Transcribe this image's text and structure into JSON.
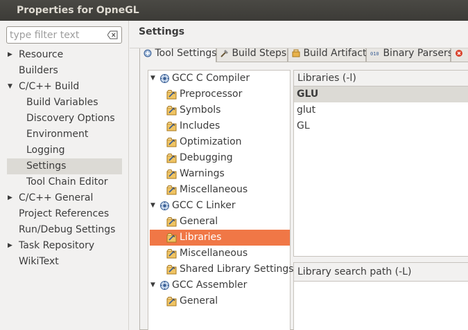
{
  "window": {
    "title": "Properties for OpneGL"
  },
  "filter": {
    "placeholder": "type filter text",
    "value": ""
  },
  "nav": [
    {
      "label": "Resource",
      "expandable": true,
      "expanded": false,
      "level": 0
    },
    {
      "label": "Builders",
      "expandable": false,
      "level": 0
    },
    {
      "label": "C/C++ Build",
      "expandable": true,
      "expanded": true,
      "level": 0
    },
    {
      "label": "Build Variables",
      "level": 1
    },
    {
      "label": "Discovery Options",
      "level": 1
    },
    {
      "label": "Environment",
      "level": 1
    },
    {
      "label": "Logging",
      "level": 1
    },
    {
      "label": "Settings",
      "level": 1,
      "selected": true
    },
    {
      "label": "Tool Chain Editor",
      "level": 1
    },
    {
      "label": "C/C++ General",
      "expandable": true,
      "expanded": false,
      "level": 0
    },
    {
      "label": "Project References",
      "level": 0
    },
    {
      "label": "Run/Debug Settings",
      "level": 0
    },
    {
      "label": "Task Repository",
      "expandable": true,
      "expanded": false,
      "level": 0
    },
    {
      "label": "WikiText",
      "level": 0
    }
  ],
  "page": {
    "title": "Settings"
  },
  "tabs": [
    {
      "label": "Tool Settings",
      "active": true
    },
    {
      "label": "Build Steps"
    },
    {
      "label": "Build Artifact"
    },
    {
      "label": "Binary Parsers"
    }
  ],
  "tree": [
    {
      "label": "GCC C Compiler",
      "level": 0
    },
    {
      "label": "Preprocessor",
      "level": 1
    },
    {
      "label": "Symbols",
      "level": 1
    },
    {
      "label": "Includes",
      "level": 1
    },
    {
      "label": "Optimization",
      "level": 1
    },
    {
      "label": "Debugging",
      "level": 1
    },
    {
      "label": "Warnings",
      "level": 1
    },
    {
      "label": "Miscellaneous",
      "level": 1
    },
    {
      "label": "GCC C Linker",
      "level": 0
    },
    {
      "label": "General",
      "level": 1
    },
    {
      "label": "Libraries",
      "level": 1,
      "selected": true
    },
    {
      "label": "Miscellaneous",
      "level": 1
    },
    {
      "label": "Shared Library Settings",
      "level": 1
    },
    {
      "label": "GCC Assembler",
      "level": 0
    },
    {
      "label": "General",
      "level": 1
    }
  ],
  "libraries": {
    "header": "Libraries (-l)",
    "items": [
      "GLU",
      "glut",
      "GL"
    ],
    "selected": "GLU"
  },
  "search_path": {
    "header": "Library search path (-L)"
  },
  "colors": {
    "selection": "#f07746",
    "titlebar": "#3c3b37"
  }
}
